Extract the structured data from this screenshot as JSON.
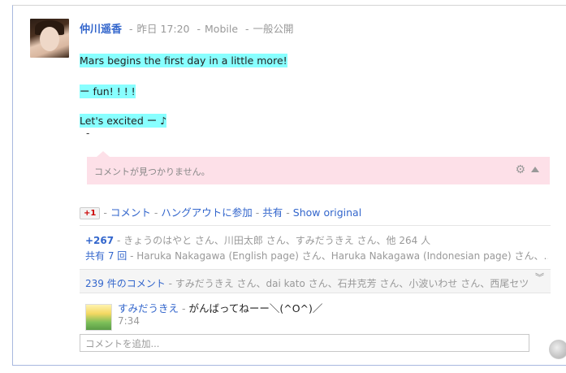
{
  "post": {
    "author": "仲川遥香",
    "time": "昨日 17:20",
    "source": "Mobile",
    "visibility": "一般公開",
    "lines": [
      "Mars begins the first day in a little more!",
      "ー fun! ! ! !",
      "Let's excited ー ♪"
    ],
    "dash": "-"
  },
  "comment_notice": {
    "text": "コメントが見つかりません。",
    "icons": [
      "gear-icon",
      "collapse-up-icon"
    ]
  },
  "actions": {
    "plus_one": "+1",
    "comment": "コメント",
    "hangout": "ハングアウトに参加",
    "share": "共有",
    "show_original": "Show original"
  },
  "plus_summary": {
    "count": "+267",
    "people": "きょうのはやと さん、川田太郎 さん、すみだうきえ さん、他 264 人"
  },
  "share_summary": {
    "label": "共有 7 回",
    "people": "Haruka Nakagawa (English page) さん、Haruka Nakagawa (Indonesian page) さん、…"
  },
  "comments_summary": {
    "count_label": "239 件のコメント",
    "people": "すみだうきえ さん、dai kato さん、石井克芳 さん、小波いわせ さん、西尾セツ…"
  },
  "latest_comment": {
    "author": "すみだうきえ",
    "text": "がんばってねーー＼(^O^)／",
    "time": "7:34"
  },
  "add_comment": {
    "placeholder": "コメントを追加..."
  },
  "colors": {
    "link": "#3366cc",
    "highlight": "#88ffff",
    "notice_bg": "#fde0e8",
    "plus_one": "#cc0000"
  }
}
